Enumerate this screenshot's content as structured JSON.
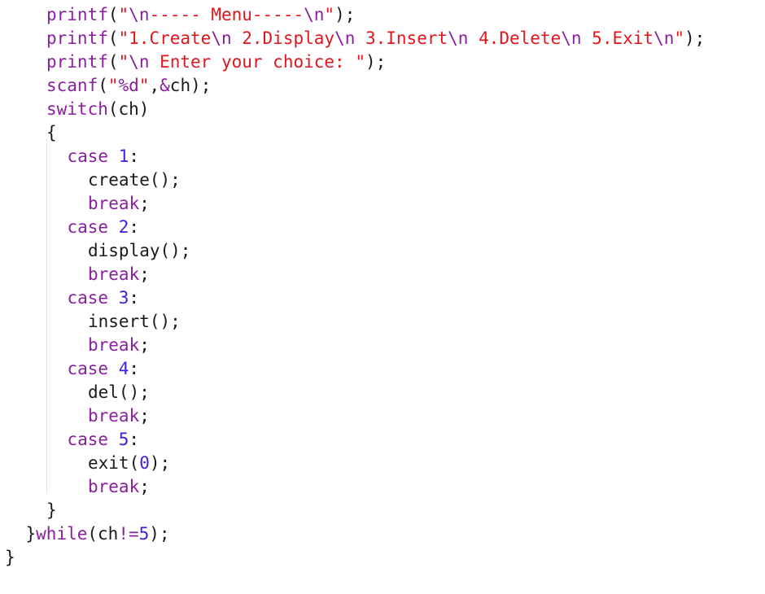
{
  "editor": {
    "language": "C",
    "colors": {
      "default": "#1a1a1a",
      "function": "#8a1fa0",
      "string": "#e0161e",
      "escape": "#8a1fa0",
      "keyword": "#8a1fa0",
      "number": "#3b1ee0",
      "guide": "#c8c8c8",
      "background": "#ffffff"
    },
    "lines": [
      {
        "indent": 2,
        "tokens": [
          {
            "t": "printf",
            "c": "func"
          },
          {
            "t": "(",
            "c": "default"
          },
          {
            "t": "\"",
            "c": "str"
          },
          {
            "t": "\\n",
            "c": "esc"
          },
          {
            "t": "----- Menu-----",
            "c": "str"
          },
          {
            "t": "\\n",
            "c": "esc"
          },
          {
            "t": "\"",
            "c": "str"
          },
          {
            "t": ");",
            "c": "default"
          }
        ]
      },
      {
        "indent": 2,
        "tokens": [
          {
            "t": "printf",
            "c": "func"
          },
          {
            "t": "(",
            "c": "default"
          },
          {
            "t": "\"1.Create",
            "c": "str"
          },
          {
            "t": "\\n",
            "c": "esc"
          },
          {
            "t": " 2.Display",
            "c": "str"
          },
          {
            "t": "\\n",
            "c": "esc"
          },
          {
            "t": " 3.Insert",
            "c": "str"
          },
          {
            "t": "\\n",
            "c": "esc"
          },
          {
            "t": " 4.Delete",
            "c": "str"
          },
          {
            "t": "\\n",
            "c": "esc"
          },
          {
            "t": " 5.Exit",
            "c": "str"
          },
          {
            "t": "\\n",
            "c": "esc"
          },
          {
            "t": "\"",
            "c": "str"
          },
          {
            "t": ");",
            "c": "default"
          }
        ]
      },
      {
        "indent": 2,
        "tokens": [
          {
            "t": "printf",
            "c": "func"
          },
          {
            "t": "(",
            "c": "default"
          },
          {
            "t": "\"",
            "c": "str"
          },
          {
            "t": "\\n",
            "c": "esc"
          },
          {
            "t": " Enter your choice: \"",
            "c": "str"
          },
          {
            "t": ");",
            "c": "default"
          }
        ]
      },
      {
        "indent": 2,
        "tokens": [
          {
            "t": "scanf",
            "c": "func"
          },
          {
            "t": "(",
            "c": "default"
          },
          {
            "t": "\"",
            "c": "str"
          },
          {
            "t": "%d",
            "c": "esc"
          },
          {
            "t": "\"",
            "c": "str"
          },
          {
            "t": ",",
            "c": "default"
          },
          {
            "t": "&",
            "c": "func"
          },
          {
            "t": "ch);",
            "c": "default"
          }
        ]
      },
      {
        "indent": 2,
        "tokens": [
          {
            "t": "switch",
            "c": "kw"
          },
          {
            "t": "(ch)",
            "c": "default"
          }
        ]
      },
      {
        "indent": 2,
        "tokens": [
          {
            "t": "{",
            "c": "default"
          }
        ]
      },
      {
        "indent": 3,
        "tokens": [
          {
            "t": "case",
            "c": "kw"
          },
          {
            "t": " ",
            "c": "default"
          },
          {
            "t": "1",
            "c": "num"
          },
          {
            "t": ":",
            "c": "default"
          }
        ]
      },
      {
        "indent": 4,
        "tokens": [
          {
            "t": "create();",
            "c": "default"
          }
        ]
      },
      {
        "indent": 4,
        "tokens": [
          {
            "t": "break",
            "c": "kw"
          },
          {
            "t": ";",
            "c": "default"
          }
        ]
      },
      {
        "indent": 3,
        "tokens": [
          {
            "t": "case",
            "c": "kw"
          },
          {
            "t": " ",
            "c": "default"
          },
          {
            "t": "2",
            "c": "num"
          },
          {
            "t": ":",
            "c": "default"
          }
        ]
      },
      {
        "indent": 4,
        "tokens": [
          {
            "t": "display();",
            "c": "default"
          }
        ]
      },
      {
        "indent": 4,
        "tokens": [
          {
            "t": "break",
            "c": "kw"
          },
          {
            "t": ";",
            "c": "default"
          }
        ]
      },
      {
        "indent": 3,
        "tokens": [
          {
            "t": "case",
            "c": "kw"
          },
          {
            "t": " ",
            "c": "default"
          },
          {
            "t": "3",
            "c": "num"
          },
          {
            "t": ":",
            "c": "default"
          }
        ]
      },
      {
        "indent": 4,
        "tokens": [
          {
            "t": "insert();",
            "c": "default"
          }
        ]
      },
      {
        "indent": 4,
        "tokens": [
          {
            "t": "break",
            "c": "kw"
          },
          {
            "t": ";",
            "c": "default"
          }
        ]
      },
      {
        "indent": 3,
        "tokens": [
          {
            "t": "case",
            "c": "kw"
          },
          {
            "t": " ",
            "c": "default"
          },
          {
            "t": "4",
            "c": "num"
          },
          {
            "t": ":",
            "c": "default"
          }
        ]
      },
      {
        "indent": 4,
        "tokens": [
          {
            "t": "del();",
            "c": "default"
          }
        ]
      },
      {
        "indent": 4,
        "tokens": [
          {
            "t": "break",
            "c": "kw"
          },
          {
            "t": ";",
            "c": "default"
          }
        ]
      },
      {
        "indent": 3,
        "tokens": [
          {
            "t": "case",
            "c": "kw"
          },
          {
            "t": " ",
            "c": "default"
          },
          {
            "t": "5",
            "c": "num"
          },
          {
            "t": ":",
            "c": "default"
          }
        ]
      },
      {
        "indent": 4,
        "tokens": [
          {
            "t": "exit",
            "c": "default"
          },
          {
            "t": "(",
            "c": "default"
          },
          {
            "t": "0",
            "c": "num"
          },
          {
            "t": ");",
            "c": "default"
          }
        ]
      },
      {
        "indent": 4,
        "tokens": [
          {
            "t": "break",
            "c": "kw"
          },
          {
            "t": ";",
            "c": "default"
          }
        ]
      },
      {
        "indent": 2,
        "tokens": [
          {
            "t": "}",
            "c": "default"
          }
        ]
      },
      {
        "indent": 1,
        "tokens": [
          {
            "t": "}",
            "c": "default"
          },
          {
            "t": "while",
            "c": "kw"
          },
          {
            "t": "(ch",
            "c": "default"
          },
          {
            "t": "!=",
            "c": "func"
          },
          {
            "t": "5",
            "c": "num"
          },
          {
            "t": ");",
            "c": "default"
          }
        ]
      },
      {
        "indent": 0,
        "tokens": [
          {
            "t": "}",
            "c": "default"
          }
        ]
      }
    ]
  }
}
